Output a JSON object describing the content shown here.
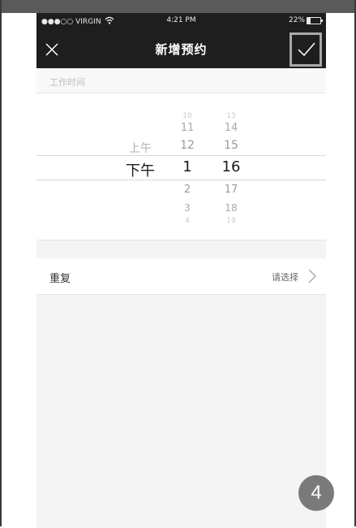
{
  "status_bar": {
    "carrier": "●●●○○ VIRGIN",
    "time": "4:21 PM",
    "battery": "22%"
  },
  "nav": {
    "title": "新增预约"
  },
  "section": {
    "label": "工作时间"
  },
  "picker": {
    "ampm": [
      "上午",
      "下午"
    ],
    "ampm_selected": "下午",
    "hours": [
      "10",
      "11",
      "12",
      "1",
      "2",
      "3",
      "4"
    ],
    "hour_selected": "1",
    "minutes": [
      "13",
      "14",
      "15",
      "16",
      "17",
      "18",
      "19"
    ],
    "minute_selected": "16"
  },
  "repeat": {
    "label": "重复",
    "value": "请选择"
  },
  "step_badge": "4"
}
